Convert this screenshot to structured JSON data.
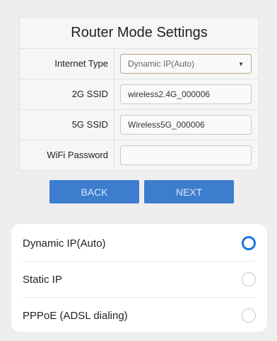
{
  "form": {
    "title": "Router Mode Settings",
    "internet_type": {
      "label": "Internet Type",
      "value": "Dynamic IP(Auto)"
    },
    "ssid_2g": {
      "label": "2G SSID",
      "value": "wireless2.4G_000006"
    },
    "ssid_5g": {
      "label": "5G SSID",
      "value": "Wireless5G_000006"
    },
    "wifi_password": {
      "label": "WiFi Password",
      "value": ""
    }
  },
  "buttons": {
    "back": "BACK",
    "next": "NEXT"
  },
  "options": [
    {
      "label": "Dynamic IP(Auto)",
      "selected": true
    },
    {
      "label": "Static IP",
      "selected": false
    },
    {
      "label": "PPPoE (ADSL dialing)",
      "selected": false
    }
  ],
  "colors": {
    "button": "#3d7dce",
    "radio_selected": "#1a76e0"
  }
}
